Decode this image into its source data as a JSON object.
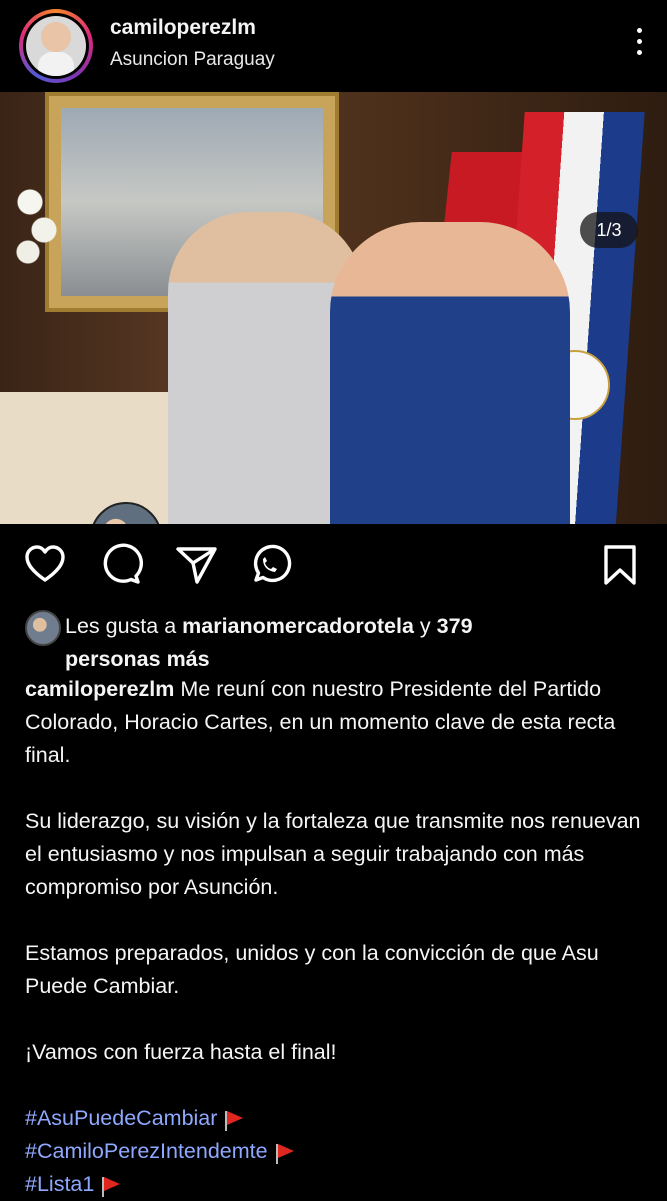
{
  "header": {
    "username": "camiloperezlm",
    "location": "Asuncion Paraguay"
  },
  "photo": {
    "counter": "1/3",
    "carousel_total": 3,
    "carousel_active": 1
  },
  "icons": {
    "like": "heart-icon",
    "comment": "comment-icon",
    "share": "send-icon",
    "whatsapp": "whatsapp-icon",
    "save": "bookmark-icon",
    "more": "more-vertical-icon",
    "tag_user": "user-icon"
  },
  "likes": {
    "prefix": "Les gusta a ",
    "user": "marianomercadorotela",
    "middle": " y ",
    "count": "379",
    "suffix_line": "personas más"
  },
  "caption": {
    "author": "camiloperezlm",
    "line1": " Me reuní con nuestro Presidente del Partido Colorado, Horacio Cartes, en un momento clave de esta recta final.",
    "para2": "Su liderazgo, su visión y la fortaleza que transmite nos renuevan el entusiasmo y nos impulsan a seguir trabajando con más compromiso por Asunción.",
    "para3": "Estamos preparados, unidos y con la convicción de que Asu Puede Cambiar.",
    "para4": "¡Vamos con fuerza hasta el final!",
    "hashtags": [
      "#AsuPuedeCambiar",
      "#CamiloPerezIntendemte",
      "#Lista1"
    ]
  },
  "colors": {
    "background": "#000000",
    "text": "#f5f5f5",
    "hashtag": "#8fa8ff",
    "carousel_active_dot": "#3897f0",
    "collab_badge": "#8a4fff"
  }
}
